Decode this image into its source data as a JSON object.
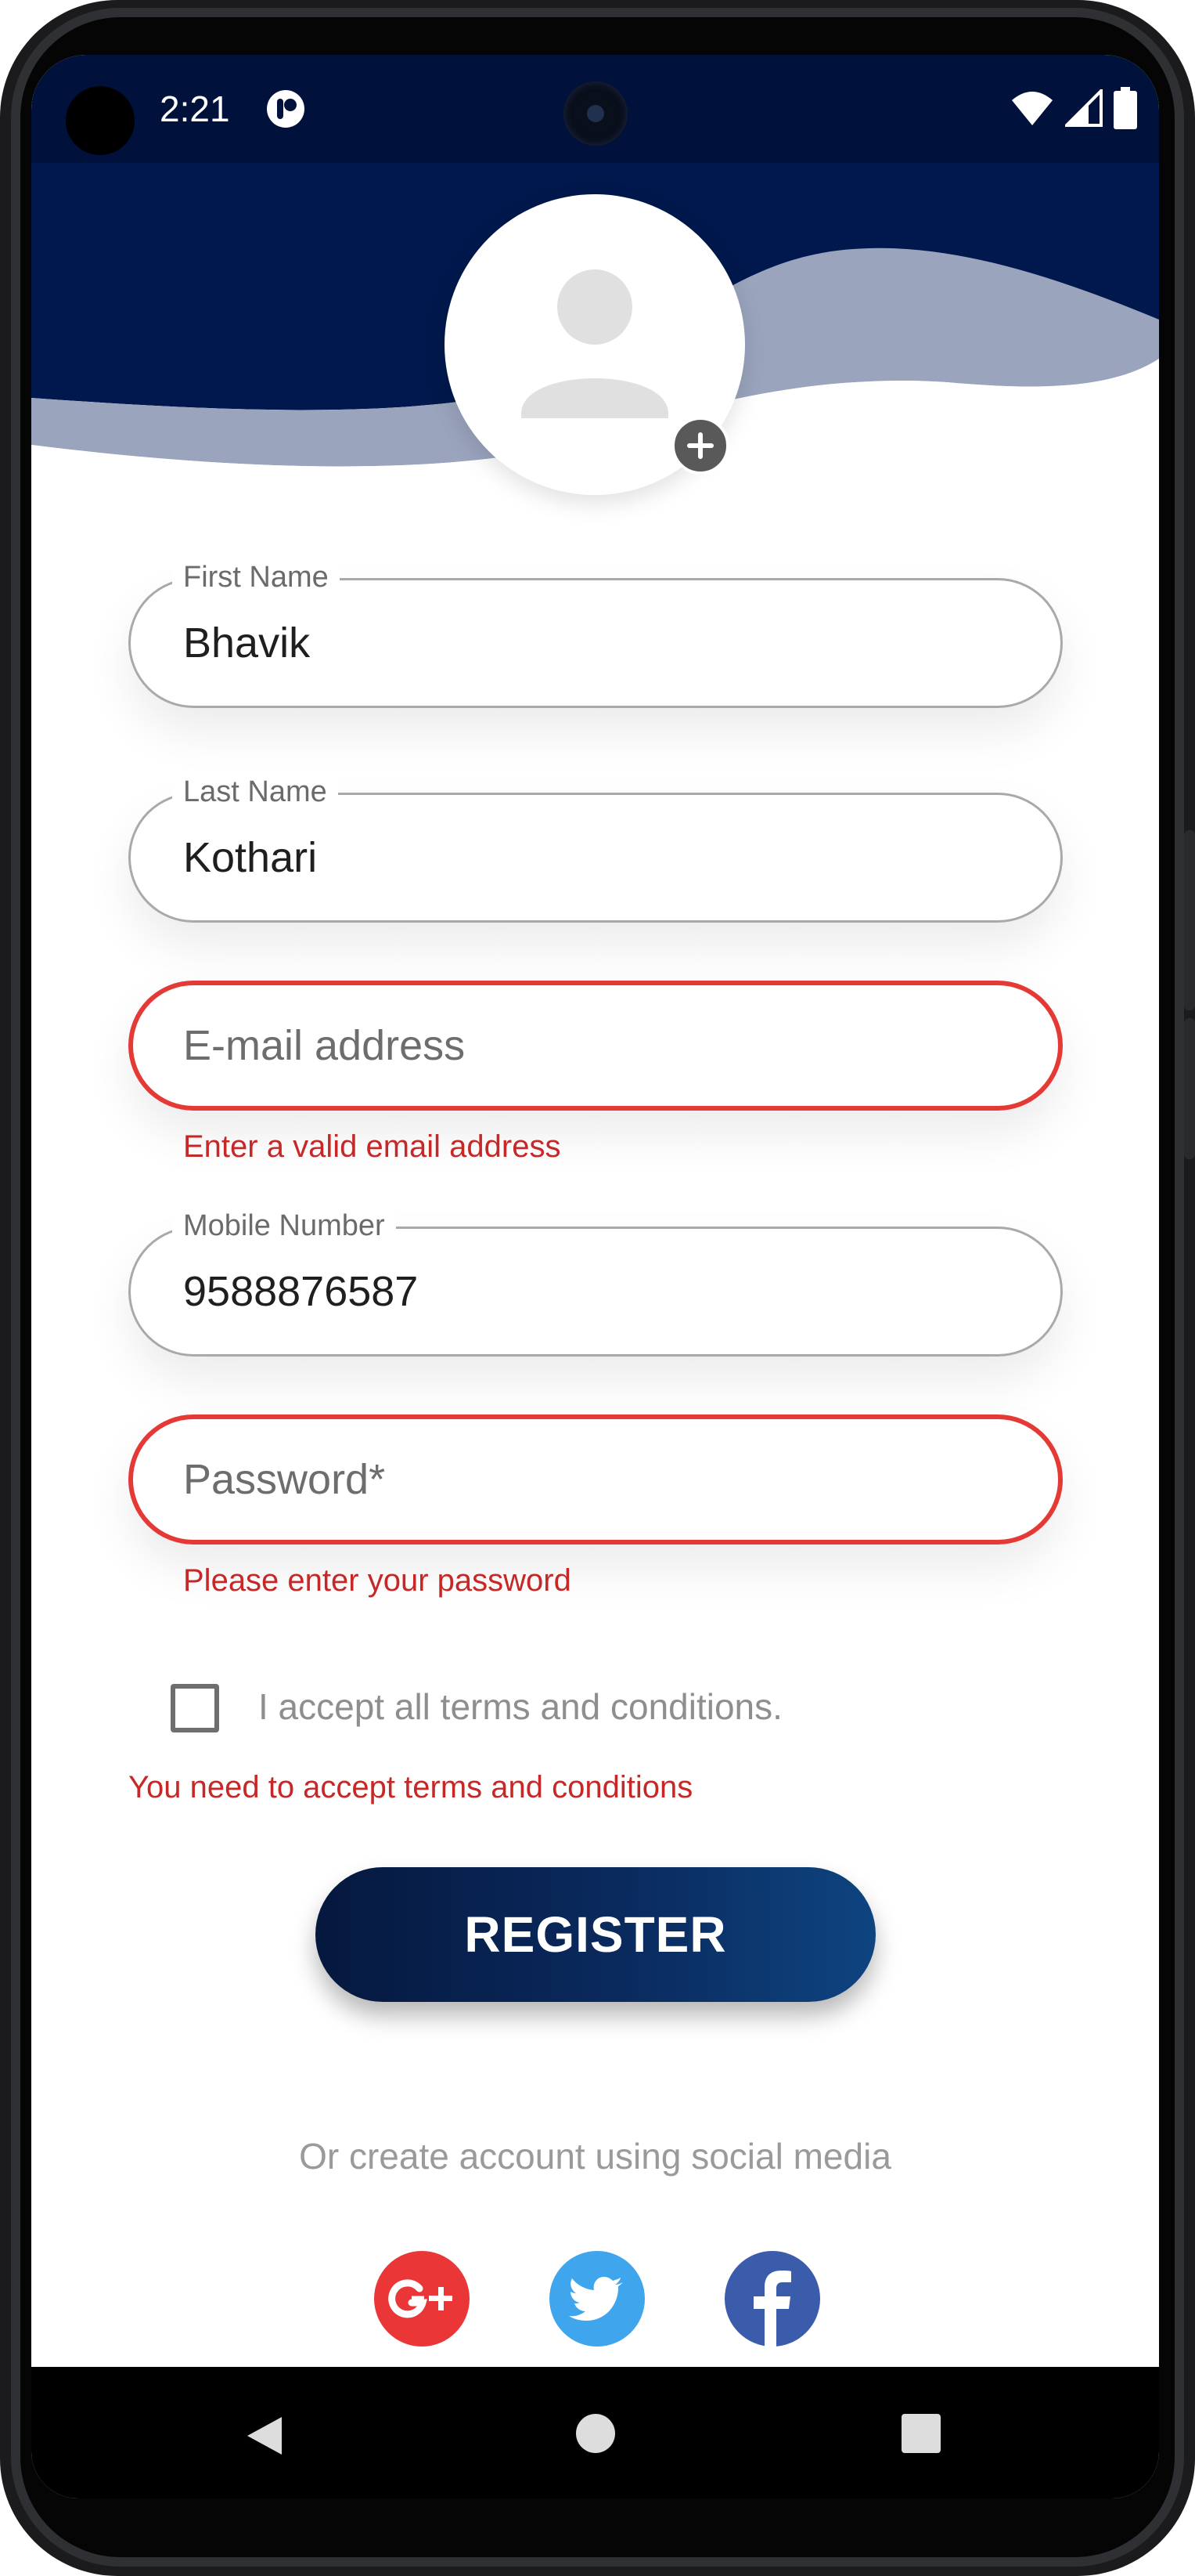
{
  "status_bar": {
    "time": "2:21"
  },
  "form": {
    "first_name": {
      "label": "First Name",
      "value": "Bhavik"
    },
    "last_name": {
      "label": "Last Name",
      "value": "Kothari"
    },
    "email": {
      "placeholder": "E-mail address",
      "error": "Enter a valid email address"
    },
    "mobile": {
      "label": "Mobile Number",
      "value": "9588876587"
    },
    "password": {
      "placeholder": "Password*",
      "error": "Please enter your password"
    },
    "terms": {
      "label": "I accept all terms and conditions.",
      "error": "You need to accept terms and conditions"
    }
  },
  "register_button": "REGISTER",
  "social": {
    "text": "Or create account using social media",
    "buttons": [
      "google-plus-icon",
      "twitter-icon",
      "facebook-icon"
    ]
  },
  "colors": {
    "header": "#00123c",
    "error": "#e53935",
    "google": "#ea3636",
    "twitter": "#3fa5ec",
    "facebook": "#3b5bab"
  }
}
